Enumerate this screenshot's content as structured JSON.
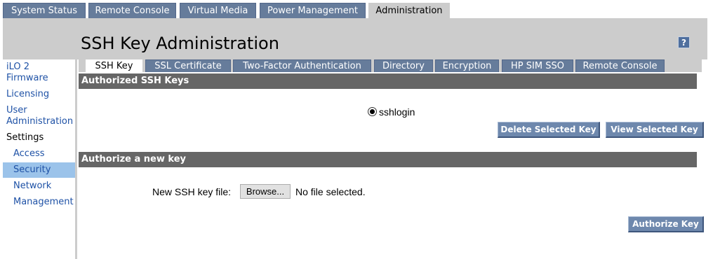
{
  "top_tabs": [
    "System Status",
    "Remote Console",
    "Virtual Media",
    "Power Management",
    "Administration"
  ],
  "page_title": "SSH Key Administration",
  "help": "?",
  "sidebar": {
    "firmware_line1": "iLO 2",
    "firmware_line2": "Firmware",
    "licensing": "Licensing",
    "user_admin_line1": "User",
    "user_admin_line2": "Administration",
    "settings": "Settings",
    "access": "Access",
    "security": "Security",
    "network": "Network",
    "management": "Management"
  },
  "sub_tabs": [
    "SSH Key",
    "SSL Certificate",
    "Two-Factor Authentication",
    "Directory",
    "Encryption",
    "HP SIM SSO",
    "Remote Console"
  ],
  "authorized": {
    "header": "Authorized SSH Keys",
    "key_name": "sshlogin",
    "delete_label": "Delete Selected Key",
    "view_label": "View Selected Key"
  },
  "new_key": {
    "header": "Authorize a new key",
    "file_label": "New SSH key file:",
    "browse_label": "Browse...",
    "file_status": "No file selected.",
    "authorize_label": "Authorize Key"
  }
}
